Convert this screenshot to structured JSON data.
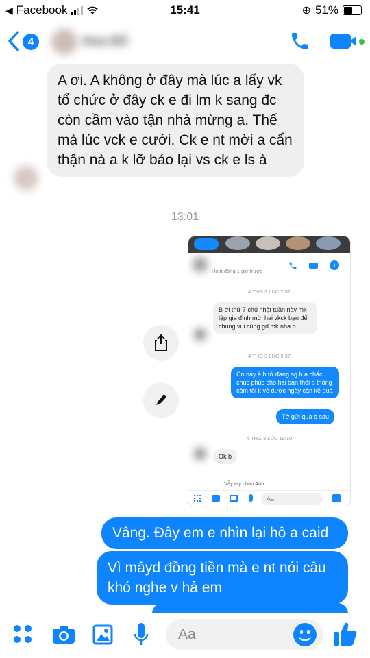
{
  "status_bar": {
    "carrier": "Facebook",
    "time": "15:41",
    "battery": "51%"
  },
  "header": {
    "back_count": "4",
    "contact_name": "Hoa Đỗ"
  },
  "colors": {
    "brand": "#0f84ff",
    "incoming_bg": "#efeff0",
    "online": "#31c24d"
  },
  "messages": {
    "incoming_1": "A ơi. A không ở đây mà lúc a lấy vk tổ chức ở đây ck e đi lm k sang đc còn cầm vào tận nhà mừng a. Thế mà lúc vck e cưới. Ck e nt mời a cẩn thận nà a k lỡ bảo lại vs ck e ls à",
    "timestamp": "13:01",
    "outgoing_1": "Vâng. Đây em e nhìn lại hộ a caid",
    "outgoing_2": "Vì mâyd đồng tiền mà e nt nói câu khó nghe v hả em"
  },
  "embedded_screenshot": {
    "status_line": "Hoạt động 1 giờ trước",
    "ts1": "4 THG 3 LÚC 7:02",
    "msg1": "B ơi thứ 7 chủ nhật tuần này mk lập gia đình mời hai vkck bạn đến chung vui cùng gd mk nha b",
    "ts2": "4 THG 3 LÚC 9:37",
    "msg2": "Cn này à b tớ đang sg b ạ chắc chúc phúc cho hai bạn thôi b thông cảm tôi k về được ngày cận kề quá",
    "msg3": "Tớ gửi quà b sau",
    "ts3": "4 THG 3 LÚC 19:10",
    "msg4": "Ok b",
    "partial": "Vẫy tay chào Anh",
    "composer_placeholder": "Aa"
  },
  "composer": {
    "placeholder": "Aa"
  },
  "icons": [
    "back-icon",
    "phone-icon",
    "video-icon",
    "share-icon",
    "edit-icon",
    "apps-icon",
    "camera-icon",
    "gallery-icon",
    "mic-icon",
    "emoji-icon",
    "like-icon",
    "wifi-icon",
    "signal-icon",
    "battery-icon",
    "lock-rotation-icon"
  ]
}
